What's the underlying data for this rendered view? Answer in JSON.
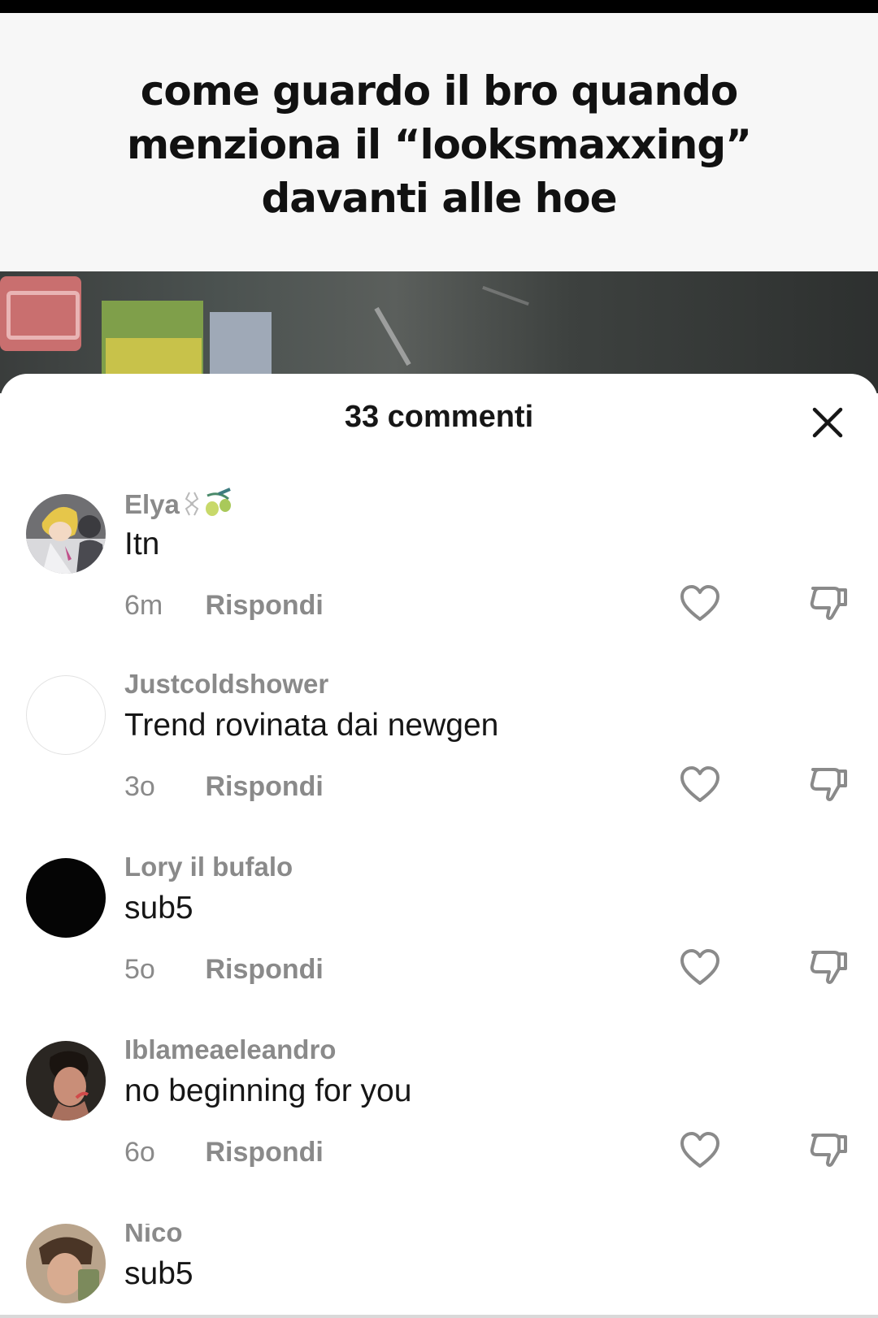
{
  "caption": {
    "text": "come guardo il bro quando\nmenziona il “looksmaxxing”\ndavanti alle hoe"
  },
  "comments_sheet": {
    "title": "33 commenti",
    "close_icon": "close-icon"
  },
  "reply_label": "Rispondi",
  "comments": [
    {
      "username": "Elya",
      "text": "Itn",
      "time": "6m",
      "reply": "Rispondi",
      "avatar": "anime-avatar"
    },
    {
      "username": "Justcoldshower",
      "text": "Trend rovinata dai newgen",
      "time": "3o",
      "reply": "Rispondi",
      "avatar": "blank-avatar"
    },
    {
      "username": "Lory il bufalo",
      "text": "sub5",
      "time": "5o",
      "reply": "Rispondi",
      "avatar": "black-avatar"
    },
    {
      "username": "Iblameaeleandro",
      "text": "no beginning for you",
      "time": "6o",
      "reply": "Rispondi",
      "avatar": "photo-avatar"
    },
    {
      "username": "Nico",
      "text": "sub5",
      "time": "",
      "reply": "",
      "avatar": "photo-avatar"
    }
  ],
  "icons": {
    "like": "heart-icon",
    "dislike": "thumbs-down-icon"
  }
}
